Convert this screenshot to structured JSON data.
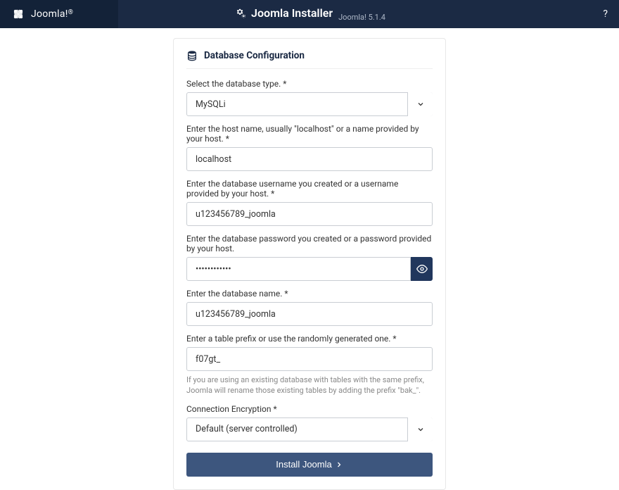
{
  "brand": "Joomla!",
  "appTitle": "Joomla Installer",
  "version": "Joomla! 5.1.4",
  "cardTitle": "Database Configuration",
  "labels": {
    "dbType": "Select the database type. *",
    "host": "Enter the host name, usually \"localhost\" or a name provided by your host. *",
    "username": "Enter the database username you created or a username provided by your host. *",
    "password": "Enter the database password you created or a password provided by your host.",
    "dbName": "Enter the database name. *",
    "prefix": "Enter a table prefix or use the randomly generated one. *",
    "encryption": "Connection Encryption *"
  },
  "values": {
    "dbType": "MySQLi",
    "host": "localhost",
    "username": "u123456789_joomla",
    "password": "••••••••••••",
    "dbName": "u123456789_joomla",
    "prefix": "f07gt_",
    "encryption": "Default (server controlled)"
  },
  "prefixHint": "If you are using an existing database with tables with the same prefix, Joomla will rename those existing tables by adding the prefix \"bak_\".",
  "installButton": "Install Joomla"
}
